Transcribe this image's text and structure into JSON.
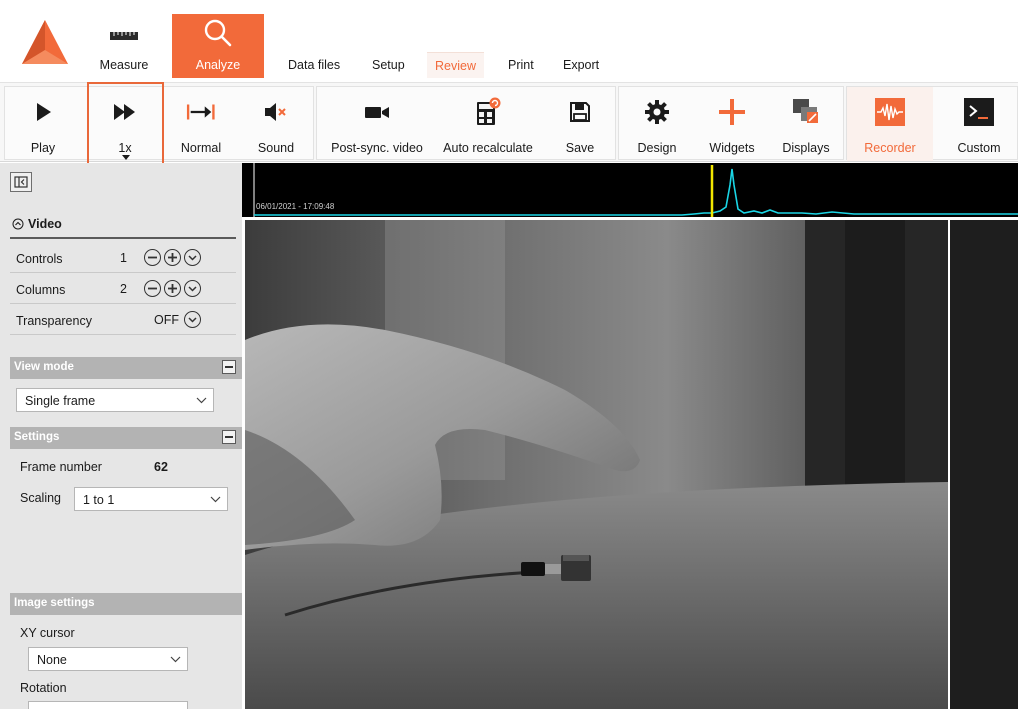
{
  "menu": {
    "tabs": [
      {
        "label": "Measure",
        "icon": "ruler-icon"
      },
      {
        "label": "Analyze",
        "icon": "magnifier-icon",
        "active": true
      }
    ],
    "subtabs": [
      {
        "label": "Data files"
      },
      {
        "label": "Setup"
      },
      {
        "label": "Review",
        "active": true
      },
      {
        "label": "Print"
      },
      {
        "label": "Export"
      }
    ]
  },
  "toolbar": {
    "play": "Play",
    "speed": "1x",
    "normal": "Normal",
    "sound": "Sound",
    "post_sync_video": "Post-sync. video",
    "auto_recalculate": "Auto recalculate",
    "save": "Save",
    "design": "Design",
    "widgets": "Widgets",
    "displays": "Displays",
    "recorder": "Recorder",
    "custom": "Custom"
  },
  "panel": {
    "video_title": "Video",
    "controls": {
      "label": "Controls",
      "value": "1"
    },
    "columns": {
      "label": "Columns",
      "value": "2"
    },
    "transparency": {
      "label": "Transparency",
      "value": "OFF"
    },
    "view_mode": {
      "title": "View mode",
      "value": "Single frame"
    },
    "settings": {
      "title": "Settings",
      "frame_number_label": "Frame number",
      "frame_number_value": "62",
      "scaling_label": "Scaling",
      "scaling_value": "1 to 1"
    },
    "image_settings": {
      "title": "Image settings",
      "xy_cursor_label": "XY cursor",
      "xy_cursor_value": "None",
      "rotation_label": "Rotation"
    }
  },
  "timeline": {
    "timestamp": "06/01/2021 - 17:09:48"
  },
  "colors": {
    "accent": "#f26a3a",
    "signal": "#1ad6e6",
    "cursor": "#f3e600"
  }
}
